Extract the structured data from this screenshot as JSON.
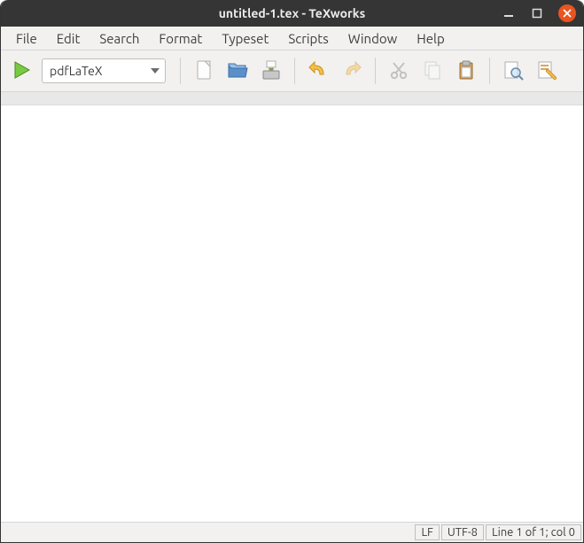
{
  "titlebar": {
    "title": "untitled-1.tex - TeXworks"
  },
  "menubar": {
    "items": [
      "File",
      "Edit",
      "Search",
      "Format",
      "Typeset",
      "Scripts",
      "Window",
      "Help"
    ]
  },
  "toolbar": {
    "engine_selected": "pdfLaTeX",
    "icons": {
      "typeset": "typeset-icon",
      "new": "new-icon",
      "open": "open-icon",
      "save": "save-icon",
      "undo": "undo-icon",
      "redo": "redo-icon",
      "cut": "cut-icon",
      "copy": "copy-icon",
      "paste": "paste-icon",
      "find": "find-icon",
      "replace": "replace-icon"
    }
  },
  "editor": {
    "content": ""
  },
  "statusbar": {
    "line_ending": "LF",
    "encoding": "UTF-8",
    "position": "Line 1 of 1; col 0"
  }
}
